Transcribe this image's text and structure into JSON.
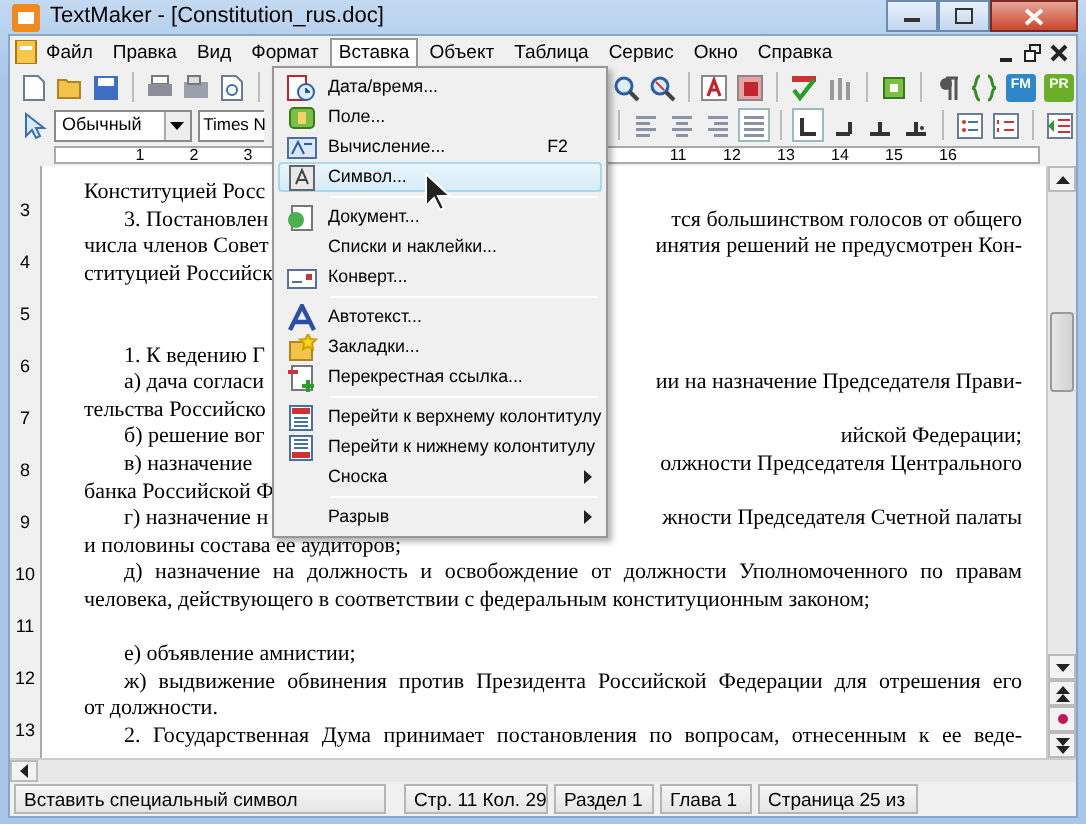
{
  "window": {
    "title": "TextMaker - [Constitution_rus.doc]"
  },
  "menu_bar": [
    {
      "label": "Файл",
      "selected": false
    },
    {
      "label": "Правка",
      "selected": false
    },
    {
      "label": "Вид",
      "selected": false
    },
    {
      "label": "Формат",
      "selected": false
    },
    {
      "label": "Вставка",
      "selected": true
    },
    {
      "label": "Объект",
      "selected": false
    },
    {
      "label": "Таблица",
      "selected": false
    },
    {
      "label": "Сервис",
      "selected": false
    },
    {
      "label": "Окно",
      "selected": false
    },
    {
      "label": "Справка",
      "selected": false
    }
  ],
  "toolbar": {
    "style": "Обычный",
    "font": "Times N",
    "badges": [
      "FM",
      "PR"
    ]
  },
  "ruler": {
    "left_numbers": [
      "1",
      "2",
      "3"
    ],
    "right_numbers": [
      "11",
      "12",
      "13",
      "14",
      "15",
      "16"
    ],
    "side_numbers": [
      "3",
      "4",
      "5",
      "6",
      "7",
      "8",
      "9",
      "10",
      "11",
      "12",
      "13"
    ]
  },
  "insert_menu": [
    {
      "kind": "item",
      "label": "Дата/время...",
      "selected": false,
      "submenu": false
    },
    {
      "kind": "item",
      "label": "Поле...",
      "selected": false,
      "submenu": false
    },
    {
      "kind": "item",
      "label": "Вычисление...",
      "shortcut": "F2",
      "selected": false,
      "submenu": false
    },
    {
      "kind": "item",
      "label": "Символ...",
      "selected": true,
      "submenu": false
    },
    {
      "kind": "separator"
    },
    {
      "kind": "item",
      "label": "Документ...",
      "selected": false,
      "submenu": false
    },
    {
      "kind": "item",
      "label": "Списки и наклейки...",
      "selected": false,
      "submenu": false
    },
    {
      "kind": "item",
      "label": "Конверт...",
      "selected": false,
      "submenu": false
    },
    {
      "kind": "separator"
    },
    {
      "kind": "item",
      "label": "Автотекст...",
      "selected": false,
      "submenu": false
    },
    {
      "kind": "item",
      "label": "Закладки...",
      "selected": false,
      "submenu": false
    },
    {
      "kind": "item",
      "label": "Перекрестная ссылка...",
      "selected": false,
      "submenu": false
    },
    {
      "kind": "separator"
    },
    {
      "kind": "item",
      "label": "Перейти к верхнему колонтитулу",
      "selected": false,
      "submenu": false
    },
    {
      "kind": "item",
      "label": "Перейти к нижнему колонтитулу",
      "selected": false,
      "submenu": false
    },
    {
      "kind": "item",
      "label": "Сноска",
      "selected": false,
      "submenu": true
    },
    {
      "kind": "separator"
    },
    {
      "kind": "item",
      "label": "Разрыв",
      "selected": false,
      "submenu": true
    }
  ],
  "document": [
    {
      "kind": "split",
      "left": "Конституцией Росс",
      "indent": false
    },
    {
      "kind": "split",
      "left": "3.  Постановлен",
      "right": "тся большинством голосов от общего",
      "indent": true
    },
    {
      "kind": "split",
      "left": "числа членов Совет",
      "right": "инятия решений не предусмотрен Кон-",
      "indent": false
    },
    {
      "kind": "split",
      "left": "ституцией Российск",
      "indent": false
    },
    {
      "kind": "blank"
    },
    {
      "kind": "blank"
    },
    {
      "kind": "split",
      "left": "1. К ведению Г",
      "indent": true
    },
    {
      "kind": "split",
      "left": "а) дача согласи",
      "right": "ии на назначение Председателя Прави-",
      "indent": true
    },
    {
      "kind": "split",
      "left": "тельства Российско",
      "indent": false
    },
    {
      "kind": "split",
      "left": "б) решение вог",
      "right": "ийской Федерации;",
      "indent": true
    },
    {
      "kind": "split",
      "left": "в) назначение",
      "right": "олжности Председателя Центрального",
      "indent": true
    },
    {
      "kind": "split",
      "left": "банка Российской Ф",
      "indent": false
    },
    {
      "kind": "split",
      "left": "г) назначение н",
      "right": "жности Председателя Счетной палаты",
      "indent": true
    },
    {
      "kind": "full",
      "text": "и половины состава ее аудиторов;",
      "indent": false,
      "justify": false
    },
    {
      "kind": "full",
      "text": "д) назначение на должность и освобождение от должности Уполномоченного по правам",
      "indent": true,
      "justify": true
    },
    {
      "kind": "full",
      "text": "человека, действующего в соответствии с федеральным конституционным законом;",
      "indent": false,
      "justify": false
    },
    {
      "kind": "blank"
    },
    {
      "kind": "full",
      "text": "е) объявление амнистии;",
      "indent": true,
      "justify": false
    },
    {
      "kind": "full",
      "text": "ж) выдвижение обвинения против Президента Российской Федерации для отрешения его",
      "indent": true,
      "justify": true
    },
    {
      "kind": "full",
      "text": "от должности.",
      "indent": false,
      "justify": false
    },
    {
      "kind": "full",
      "text": "2. Государственная Дума принимает постановления по вопросам, отнесенным к ее веде-",
      "indent": true,
      "justify": true
    }
  ],
  "status_bar": [
    "Вставить специальный символ",
    "Стр. 11 Кол. 29",
    "Раздел 1",
    "Глава 1",
    "Страница 25 из"
  ]
}
